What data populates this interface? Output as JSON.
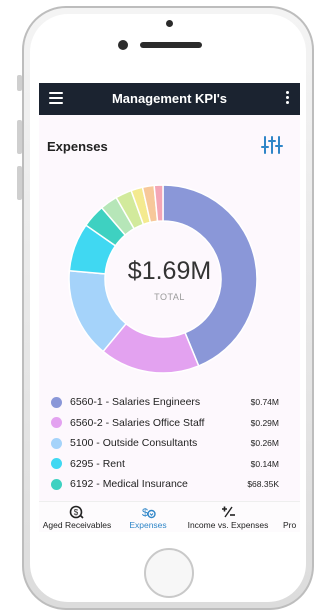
{
  "app": {
    "title": "Management KPI's"
  },
  "section": {
    "title": "Expenses"
  },
  "donut": {
    "total_value": "$1.69M",
    "total_label": "TOTAL",
    "segments": [
      {
        "fraction": 0.438,
        "color": "#8a97d8"
      },
      {
        "fraction": 0.172,
        "color": "#e3a2f0"
      },
      {
        "fraction": 0.154,
        "color": "#a5d3fa"
      },
      {
        "fraction": 0.083,
        "color": "#40d8f2"
      },
      {
        "fraction": 0.04,
        "color": "#3ed1c1"
      },
      {
        "fraction": 0.03,
        "color": "#b6e6b8"
      },
      {
        "fraction": 0.028,
        "color": "#d2ea9c"
      },
      {
        "fraction": 0.02,
        "color": "#f4ea90"
      },
      {
        "fraction": 0.02,
        "color": "#f7c89a"
      },
      {
        "fraction": 0.015,
        "color": "#f4a6b6"
      }
    ]
  },
  "legend": [
    {
      "label": "6560-1 - Salaries Engineers",
      "value": "$0.74M",
      "color": "#8a97d8"
    },
    {
      "label": "6560-2 - Salaries Office Staff",
      "value": "$0.29M",
      "color": "#e3a2f0"
    },
    {
      "label": "5100 - Outside Consultants",
      "value": "$0.26M",
      "color": "#a5d3fa"
    },
    {
      "label": "6295 - Rent",
      "value": "$0.14M",
      "color": "#40d8f2"
    },
    {
      "label": "6192 - Medical Insurance",
      "value": "$68.35K",
      "color": "#3ed1c1"
    }
  ],
  "tabs": [
    {
      "label": "Aged Receivables",
      "icon": "dollar-clock-icon",
      "active": false
    },
    {
      "label": "Expenses",
      "icon": "dollar-down-icon",
      "active": true
    },
    {
      "label": "Income vs. Expenses",
      "icon": "plus-minus-icon",
      "active": false
    },
    {
      "label": "Pro",
      "icon": "profit-icon",
      "active": false
    }
  ],
  "colors": {
    "appbar": "#1b2330",
    "accent": "#2f86c8",
    "background": "#fdf8fd"
  }
}
